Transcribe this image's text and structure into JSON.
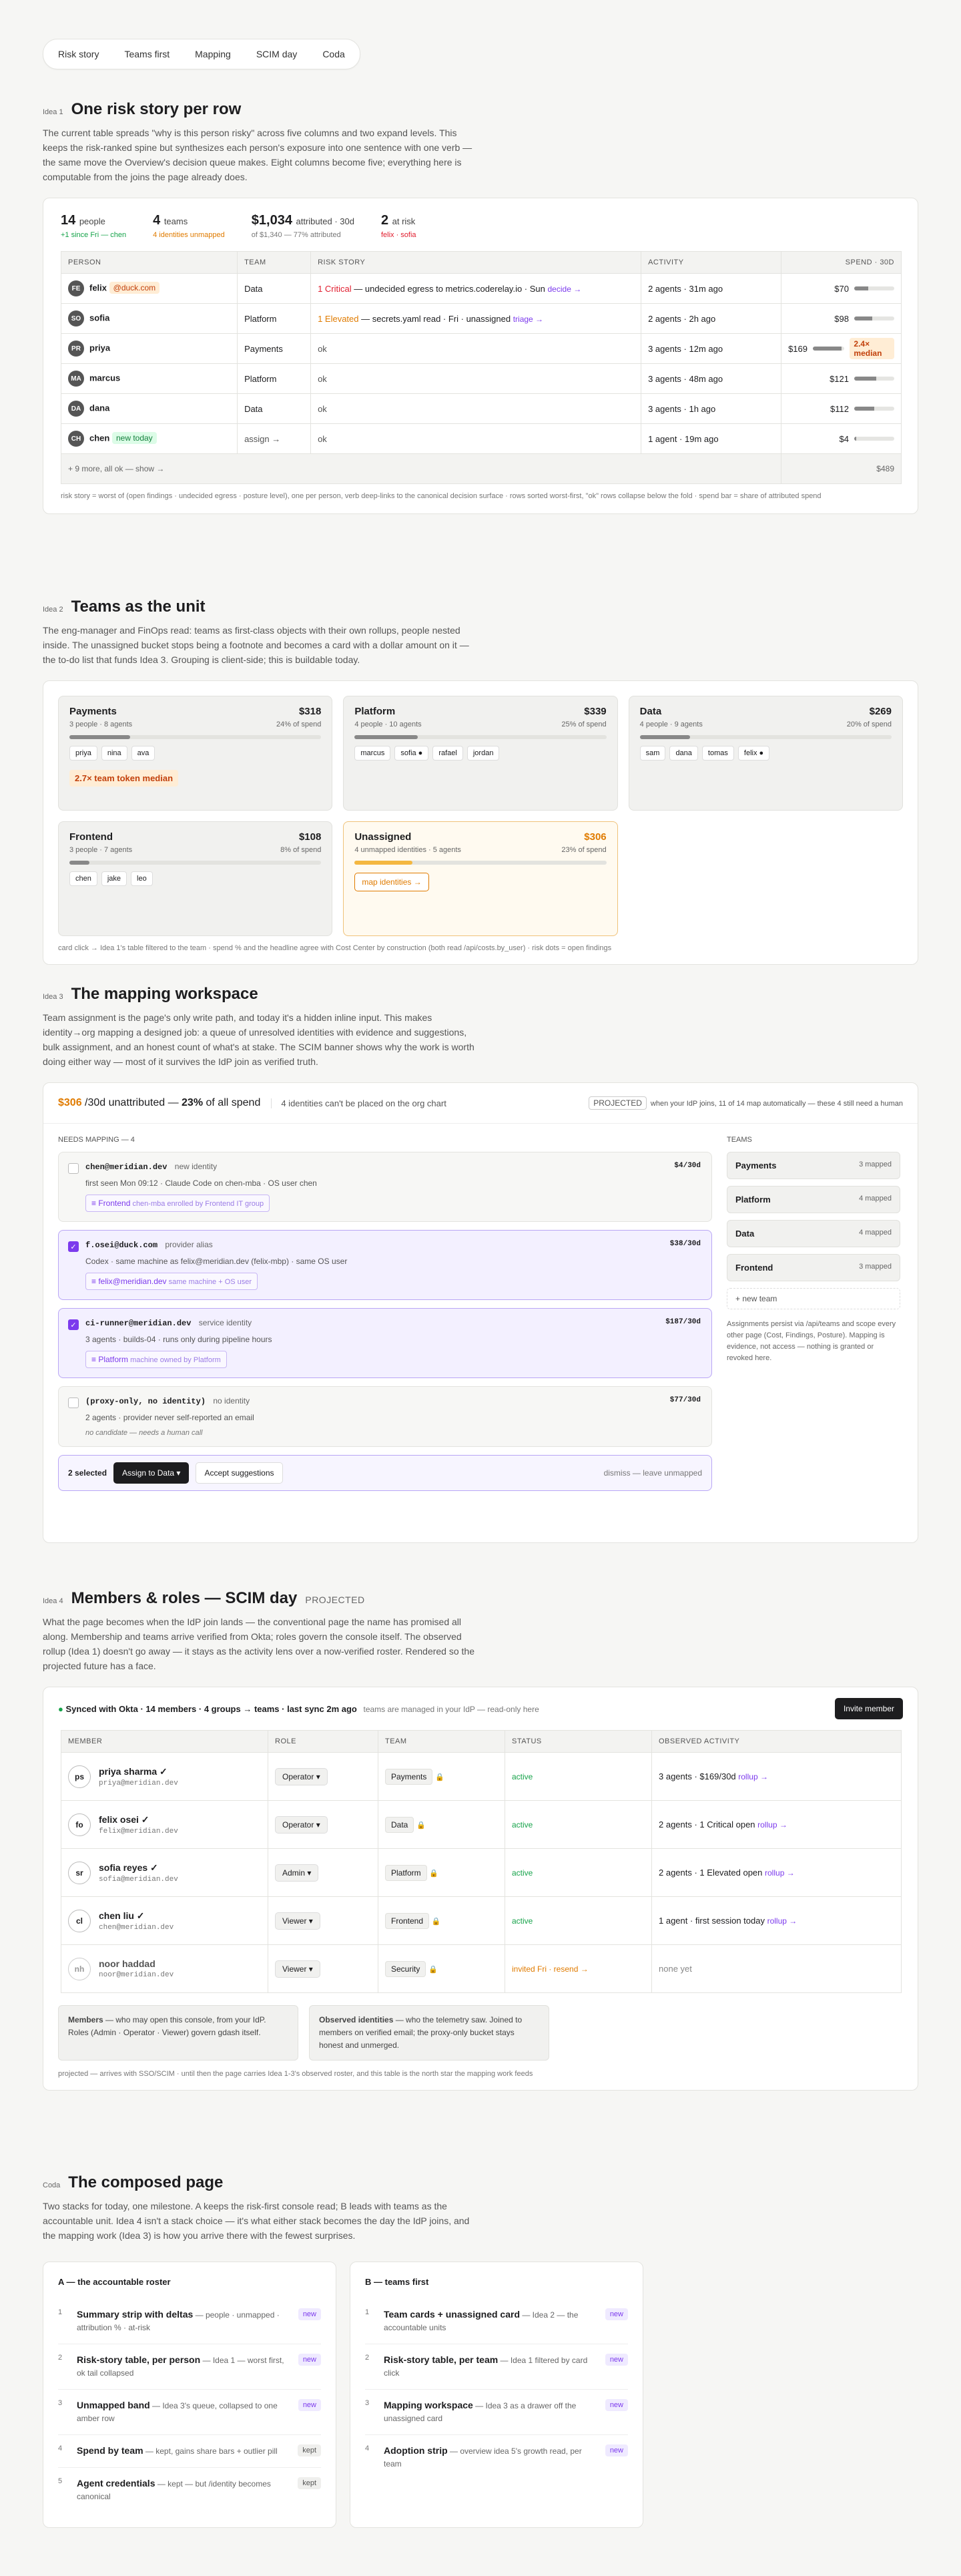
{
  "tabs": [
    "Risk story",
    "Teams first",
    "Mapping",
    "SCIM day",
    "Coda"
  ],
  "idea1": {
    "num": "Idea 1",
    "title": "One risk story per row",
    "intro": "The current table spreads \"why is this person risky\" across five columns and two expand levels. This keeps the risk-ranked spine but synthesizes each person's exposure into one sentence with one verb — the same move the Overview's decision queue makes. Eight columns become five; everything here is computable from the joins the page already does.",
    "stats": [
      {
        "big": "14",
        "unit": "people",
        "sub": "+1 since Fri — chen",
        "color": "#16a34a"
      },
      {
        "big": "4",
        "unit": "teams",
        "sub": "4 identities unmapped",
        "color": "#e07b00"
      },
      {
        "big": "$1,034",
        "unit": "attributed · 30d",
        "sub": "of $1,340 — 77% attributed",
        "color": "#777"
      },
      {
        "big": "2",
        "unit": "at risk",
        "sub": "felix · sofia",
        "color": "#e11d2e"
      }
    ],
    "headers": [
      "PERSON",
      "TEAM",
      "RISK STORY",
      "ACTIVITY",
      "SPEND · 30D"
    ],
    "rows": [
      {
        "initials": "FE",
        "name": "felix",
        "tag": "@duck.com",
        "team": "Data",
        "sev": "1 Critical",
        "sevcolor": "#e11d2e",
        "story": " — undecided egress to metrics.coderelay.io · Sun ",
        "verb": "decide →",
        "activity": "2 agents · 31m ago",
        "spend": "$70",
        "pct": 0.35,
        "badge": ""
      },
      {
        "initials": "SO",
        "name": "sofia",
        "tag": "",
        "team": "Platform",
        "sev": "1 Elevated",
        "sevcolor": "#e07b00",
        "story": " — secrets.yaml read · Fri · unassigned ",
        "verb": "triage →",
        "activity": "2 agents · 2h ago",
        "spend": "$98",
        "pct": 0.45,
        "badge": ""
      },
      {
        "initials": "PR",
        "name": "priya",
        "tag": "",
        "team": "Payments",
        "sev": "",
        "sevcolor": "",
        "story": "ok",
        "verb": "",
        "activity": "3 agents · 12m ago",
        "spend": "$169",
        "pct": 0.9,
        "badge": "2.4× median"
      },
      {
        "initials": "MA",
        "name": "marcus",
        "tag": "",
        "team": "Platform",
        "sev": "",
        "sevcolor": "",
        "story": "ok",
        "verb": "",
        "activity": "3 agents · 48m ago",
        "spend": "$121",
        "pct": 0.55,
        "badge": ""
      },
      {
        "initials": "DA",
        "name": "dana",
        "tag": "",
        "team": "Data",
        "sev": "",
        "sevcolor": "",
        "story": "ok",
        "verb": "",
        "activity": "3 agents · 1h ago",
        "spend": "$112",
        "pct": 0.5,
        "badge": ""
      },
      {
        "initials": "CH",
        "name": "chen",
        "tag": "new today",
        "team": "assign →",
        "sev": "",
        "sevcolor": "",
        "story": "ok",
        "verb": "",
        "activity": "1 agent · 19m ago",
        "spend": "$4",
        "pct": 0.05,
        "badge": ""
      }
    ],
    "more": "+ 9 more, all ok — show →",
    "moretotal": "$489",
    "foot": "risk story = worst of (open findings · undecided egress · posture level), one per person, verb deep-links to the canonical decision surface · rows sorted worst-first, \"ok\" rows collapse below the fold · spend bar = share of attributed spend"
  },
  "idea2": {
    "num": "Idea 2",
    "title": "Teams as the unit",
    "intro": "The eng-manager and FinOps read: teams as first-class objects with their own rollups, people nested inside. The unassigned bucket stops being a footnote and becomes a card with a dollar amount on it — the to-do list that funds Idea 3. Grouping is client-side; this is buildable today.",
    "teams": [
      {
        "name": "Payments",
        "amt": "$318",
        "meta": "3 people · 8 agents",
        "pct": "24% of spend",
        "share": 0.24,
        "people": [
          "priya",
          "nina",
          "ava"
        ],
        "note": "2.7× team token median"
      },
      {
        "name": "Platform",
        "amt": "$339",
        "meta": "4 people · 10 agents",
        "pct": "25% of spend",
        "share": 0.25,
        "people": [
          "marcus",
          "sofia ●",
          "rafael",
          "jordan"
        ],
        "note": ""
      },
      {
        "name": "Data",
        "amt": "$269",
        "meta": "4 people · 9 agents",
        "pct": "20% of spend",
        "share": 0.2,
        "people": [
          "sam",
          "dana",
          "tomas",
          "felix ●"
        ],
        "note": ""
      },
      {
        "name": "Frontend",
        "amt": "$108",
        "meta": "3 people · 7 agents",
        "pct": "8% of spend",
        "share": 0.08,
        "people": [
          "chen",
          "jake",
          "leo"
        ],
        "note": ""
      },
      {
        "name": "Unassigned",
        "amt": "$306",
        "meta": "4 unmapped identities · 5 agents",
        "pct": "23% of spend",
        "share": 0.23,
        "people": [],
        "note": "map identities →"
      }
    ],
    "foot": "card click → Idea 1's table filtered to the team · spend % and the headline agree with Cost Center by construction (both read /api/costs.by_user) · risk dots = open findings"
  },
  "idea3": {
    "num": "Idea 3",
    "title": "The mapping workspace",
    "intro": "Team assignment is the page's only write path, and today it's a hidden inline input. This makes identity→org mapping a designed job: a queue of unresolved identities with evidence and suggestions, bulk assignment, and an honest count of what's at stake. The SCIM banner shows why the work is worth doing either way — most of it survives the IdP join as verified truth.",
    "headamt": "$306",
    "headtxt": " /30d unattributed — ",
    "headpct": "23%",
    "headtail": " of all spend",
    "headnote": "4 identities can't be placed on the org chart",
    "proj": "PROJECTED",
    "projnote": "when your IdP joins, 11 of 14 map automatically — these 4 still need a human",
    "needs": "NEEDS MAPPING — 4",
    "items": [
      {
        "id": "chen@meridian.dev",
        "kind": "new identity",
        "amt": "$4/30d",
        "ev": "first seen Mon 09:12 · Claude Code on chen-mba · OS user chen",
        "sugg": "≡ Frontend",
        "why": "chen-mba enrolled by Frontend IT group",
        "sel": false
      },
      {
        "id": "f.osei@duck.com",
        "kind": "provider alias",
        "amt": "$38/30d",
        "ev": "Codex · same machine as felix@meridian.dev (felix-mbp) · same OS user",
        "sugg": "≡ felix@meridian.dev",
        "why": "same machine + OS user",
        "sel": true
      },
      {
        "id": "ci-runner@meridian.dev",
        "kind": "service identity",
        "amt": "$187/30d",
        "ev": "3 agents · builds-04 · runs only during pipeline hours",
        "sugg": "≡ Platform",
        "why": "machine owned by Platform",
        "sel": true
      },
      {
        "id": "(proxy-only, no identity)",
        "kind": "no identity",
        "amt": "$77/30d",
        "ev": "2 agents · provider never self-reported an email",
        "sugg": "",
        "why": "no candidate — needs a human call",
        "sel": false
      }
    ],
    "selected": "2 selected",
    "assign": "Assign to Data ▾",
    "accept": "Accept suggestions",
    "dismiss": "dismiss — leave unmapped",
    "teamshead": "TEAMS",
    "side": [
      {
        "n": "Payments",
        "c": "3 mapped"
      },
      {
        "n": "Platform",
        "c": "4 mapped"
      },
      {
        "n": "Data",
        "c": "4 mapped"
      },
      {
        "n": "Frontend",
        "c": "3 mapped"
      }
    ],
    "newteam": "+ new team",
    "sidenote": "Assignments persist via /api/teams and scope every other page (Cost, Findings, Posture). Mapping is evidence, not access — nothing is granted or revoked here."
  },
  "idea4": {
    "num": "Idea 4",
    "title": "Members & roles — SCIM day",
    "tag": "PROJECTED",
    "intro": "What the page becomes when the IdP join lands — the conventional page the name has promised all along. Membership and teams arrive verified from Okta; roles govern the console itself. The observed rollup (Idea 1) doesn't go away — it stays as the activity lens over a now-verified roster. Rendered so the projected future has a face.",
    "sync": "Synced with Okta · 14 members · 4 groups → teams · last sync 2m ago",
    "syncnote": "teams are managed in your IdP — read-only here",
    "invite": "Invite member",
    "headers": [
      "MEMBER",
      "ROLE",
      "TEAM",
      "STATUS",
      "OBSERVED ACTIVITY"
    ],
    "members": [
      {
        "i": "ps",
        "name": "priya sharma ✓",
        "email": "priya@meridian.dev",
        "role": "Operator ▾",
        "team": "Payments",
        "status": "active",
        "stcolor": "#16a34a",
        "act": "3 agents · $169/30d ",
        "link": "rollup →"
      },
      {
        "i": "fo",
        "name": "felix osei ✓",
        "email": "felix@meridian.dev",
        "role": "Operator ▾",
        "team": "Data",
        "status": "active",
        "stcolor": "#16a34a",
        "act": "2 agents · 1 Critical open ",
        "link": "rollup →"
      },
      {
        "i": "sr",
        "name": "sofia reyes ✓",
        "email": "sofia@meridian.dev",
        "role": "Admin ▾",
        "team": "Platform",
        "status": "active",
        "stcolor": "#16a34a",
        "act": "2 agents · 1 Elevated open ",
        "link": "rollup →"
      },
      {
        "i": "cl",
        "name": "chen liu ✓",
        "email": "chen@meridian.dev",
        "role": "Viewer ▾",
        "team": "Frontend",
        "status": "active",
        "stcolor": "#16a34a",
        "act": "1 agent · first session today ",
        "link": "rollup →"
      },
      {
        "i": "nh",
        "name": "noor haddad",
        "email": "noor@meridian.dev",
        "role": "Viewer ▾",
        "team": "Security",
        "status": "invited Fri · resend →",
        "stcolor": "#e07b00",
        "act": "none yet",
        "link": ""
      }
    ],
    "noteA_b": "Members",
    "noteA": " — who may open this console, from your IdP. Roles (Admin · Operator · Viewer) govern gdash itself.",
    "noteB_b": "Observed identities",
    "noteB": " — who the telemetry saw. Joined to members on verified email; the proxy-only bucket stays honest and unmerged.",
    "foot": "projected — arrives with SSO/SCIM · until then the page carries Idea 1-3's observed roster, and this table is the north star the mapping work feeds"
  },
  "coda": {
    "num": "Coda",
    "title": "The composed page",
    "intro": "Two stacks for today, one milestone. A keeps the risk-first console read; B leads with teams as the accountable unit. Idea 4 isn't a stack choice — it's what either stack becomes the day the IdP joins, and the mapping work (Idea 3) is how you arrive there with the fewest surprises.",
    "a_title": "A — the accountable roster",
    "a": [
      {
        "b": "Summary strip with deltas",
        "t": " — people · unmapped · attribution % · at-risk",
        "badge": "new"
      },
      {
        "b": "Risk-story table, per person",
        "t": " — Idea 1 — worst first, ok tail collapsed",
        "badge": "new"
      },
      {
        "b": "Unmapped band",
        "t": " — Idea 3's queue, collapsed to one amber row",
        "badge": "new"
      },
      {
        "b": "Spend by team",
        "t": " — kept, gains share bars + outlier pill",
        "badge": "kept"
      },
      {
        "b": "Agent credentials",
        "t": " — kept — but /identity becomes canonical",
        "badge": "kept"
      }
    ],
    "b_title": "B — teams first",
    "b": [
      {
        "b": "Team cards + unassigned card",
        "t": " — Idea 2 — the accountable units",
        "badge": "new"
      },
      {
        "b": "Risk-story table, per team",
        "t": " — Idea 1 filtered by card click",
        "badge": "new"
      },
      {
        "b": "Mapping workspace",
        "t": " — Idea 3 as a drawer off the unassigned card",
        "badge": "new"
      },
      {
        "b": "Adoption strip",
        "t": " — overview idea 5's growth read, per team",
        "badge": "new"
      }
    ]
  }
}
